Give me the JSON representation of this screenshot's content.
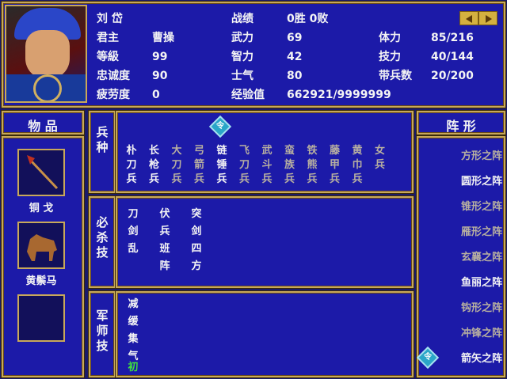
{
  "general": {
    "name": "刘 岱",
    "lord_label": "君主",
    "lord": "曹操",
    "level_label": "等級",
    "level": "99",
    "loyalty_label": "忠诚度",
    "loyalty": "90",
    "fatigue_label": "疲劳度",
    "fatigue": "0",
    "record_label": "战绩",
    "record": "0胜 0败",
    "force_label": "武力",
    "force": "69",
    "intel_label": "智力",
    "intel": "42",
    "morale_label": "士气",
    "morale": "80",
    "exp_label": "经验值",
    "exp": "662921/9999999",
    "hp_label": "体力",
    "hp": "85/216",
    "sp_label": "技力",
    "sp": "40/144",
    "troops_label": "带兵数",
    "troops": "20/200"
  },
  "items": {
    "title": "物 品",
    "list": [
      {
        "name": "铜 戈",
        "icon": "halberd-icon"
      },
      {
        "name": "黄鬃马",
        "icon": "horse-icon"
      },
      {
        "name": "",
        "icon": ""
      }
    ]
  },
  "troop_types": {
    "label": "兵种",
    "ling": "令",
    "columns": [
      {
        "text": "朴刀兵",
        "active": true
      },
      {
        "text": "长枪兵",
        "active": true
      },
      {
        "text": "大刀兵",
        "active": false
      },
      {
        "text": "弓箭兵",
        "active": false
      },
      {
        "text": "链锤兵",
        "active": true
      },
      {
        "text": "飞刀兵",
        "active": false
      },
      {
        "text": "武斗兵",
        "active": false
      },
      {
        "text": "蛮族兵",
        "active": false
      },
      {
        "text": "铁熊兵",
        "active": false
      },
      {
        "text": "藤甲兵",
        "active": false
      },
      {
        "text": "黄巾兵",
        "active": false
      },
      {
        "text": "女兵",
        "active": false
      }
    ]
  },
  "special_moves": {
    "label": "必杀技",
    "columns": [
      "刀剑乱",
      "伏兵班阵",
      "突剑四方"
    ]
  },
  "strategist": {
    "label": "军师技",
    "column": [
      "减",
      "缓",
      "集",
      "气"
    ],
    "green": "初"
  },
  "formations": {
    "title": "阵 形",
    "ling": "令",
    "list": [
      {
        "text": "方形之阵",
        "on": false
      },
      {
        "text": "圆形之阵",
        "on": true
      },
      {
        "text": "锥形之阵",
        "on": false
      },
      {
        "text": "雁形之阵",
        "on": false
      },
      {
        "text": "玄襄之阵",
        "on": false
      },
      {
        "text": "鱼丽之阵",
        "on": true
      },
      {
        "text": "钩形之阵",
        "on": false
      },
      {
        "text": "冲锋之阵",
        "on": false
      },
      {
        "text": "箭矢之阵",
        "on": true
      }
    ]
  },
  "colors": {
    "panel": "#1c1aa8",
    "border": "#c8a85a",
    "ling": "#2aa6c8",
    "green": "#40e040"
  }
}
